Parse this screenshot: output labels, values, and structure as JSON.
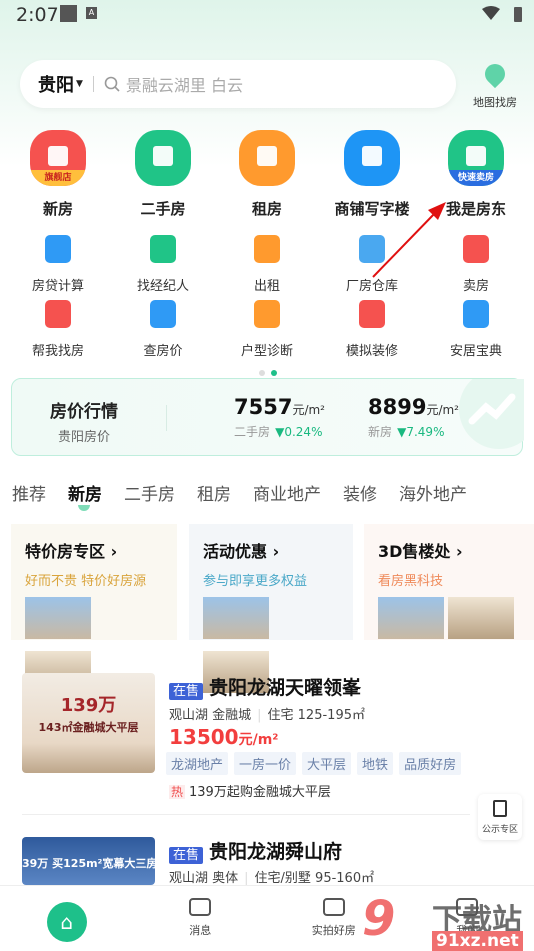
{
  "status": {
    "time": "2:07",
    "notif_icon": "A"
  },
  "search": {
    "city": "贵阳",
    "placeholder": "景融云湖里 白云"
  },
  "map_find": {
    "label": "地图找房"
  },
  "main_nav": [
    {
      "label": "新房",
      "badge": "旗舰店",
      "color": "#f5524f"
    },
    {
      "label": "二手房",
      "badge": "",
      "color": "#20c487"
    },
    {
      "label": "租房",
      "badge": "",
      "color": "#ff9a2e"
    },
    {
      "label": "商铺写字楼",
      "badge": "",
      "color": "#1e95f5"
    },
    {
      "label": "我是房东",
      "badge": "快速卖房",
      "color": "#20c487"
    }
  ],
  "sub_nav": [
    {
      "label": "房贷计算",
      "color": "#2f9af5"
    },
    {
      "label": "找经纪人",
      "color": "#20c487"
    },
    {
      "label": "出租",
      "color": "#ff9a2e"
    },
    {
      "label": "厂房仓库",
      "color": "#4aa8f0"
    },
    {
      "label": "卖房",
      "color": "#f5524f"
    },
    {
      "label": "帮我找房",
      "color": "#f5524f"
    },
    {
      "label": "查房价",
      "color": "#2f9af5"
    },
    {
      "label": "户型诊断",
      "color": "#ff9a2e"
    },
    {
      "label": "模拟装修",
      "color": "#f5524f"
    },
    {
      "label": "安居宝典",
      "color": "#2f9af5"
    }
  ],
  "pager": {
    "pages": 2,
    "current": 2
  },
  "price_card": {
    "title": "房价行情",
    "subtitle": "贵阳房价",
    "items": [
      {
        "value": "7557",
        "unit": "元/m²",
        "label": "二手房",
        "change": "0.24%"
      },
      {
        "value": "8899",
        "unit": "元/m²",
        "label": "新房",
        "change": "7.49%"
      }
    ]
  },
  "tabs": [
    {
      "label": "推荐"
    },
    {
      "label": "新房",
      "active": true
    },
    {
      "label": "二手房"
    },
    {
      "label": "租房"
    },
    {
      "label": "商业地产"
    },
    {
      "label": "装修"
    },
    {
      "label": "海外地产"
    }
  ],
  "promos": [
    {
      "title": "特价房专区",
      "subtitle": "好而不贵 特价好房源",
      "color": "#d9a43c",
      "bg": "#faf8f1"
    },
    {
      "title": "活动优惠",
      "subtitle": "参与即享更多权益",
      "color": "#4aa8c8",
      "bg": "#f3f6f9"
    },
    {
      "title": "3D售楼处",
      "subtitle": "看房黑科技",
      "color": "#ef8a5a",
      "bg": "#fdf7f4"
    }
  ],
  "listings": [
    {
      "status": "在售",
      "title": "贵阳龙湖天曜领峯",
      "area": "观山湖  金融城",
      "type": "住宅  125-195㎡",
      "price": "13500",
      "price_unit": "元/m²",
      "tags": [
        "龙湖地产",
        "一房一价",
        "大平层",
        "地铁",
        "品质好房"
      ],
      "hot_label": "热",
      "hot": "139万起购金融城大平层",
      "img_text1": "139万",
      "img_text2": "143㎡金融城大平层"
    },
    {
      "status": "在售",
      "title": "贵阳龙湖舜山府",
      "area": "观山湖  奥体",
      "type": "住宅/别墅  95-160㎡",
      "img_text1": "39万 买125m²宽幕大三房"
    }
  ],
  "float_btn": {
    "label": "公示专区"
  },
  "bottom_nav": [
    {
      "label": "首页",
      "icon": "home-icon"
    },
    {
      "label": "消息",
      "icon": "message-icon"
    },
    {
      "label": "实拍好房",
      "icon": "video-icon"
    },
    {
      "label": "我的",
      "icon": "profile-icon"
    }
  ],
  "watermark": {
    "text": "91下载站",
    "url": "91xz.net"
  }
}
